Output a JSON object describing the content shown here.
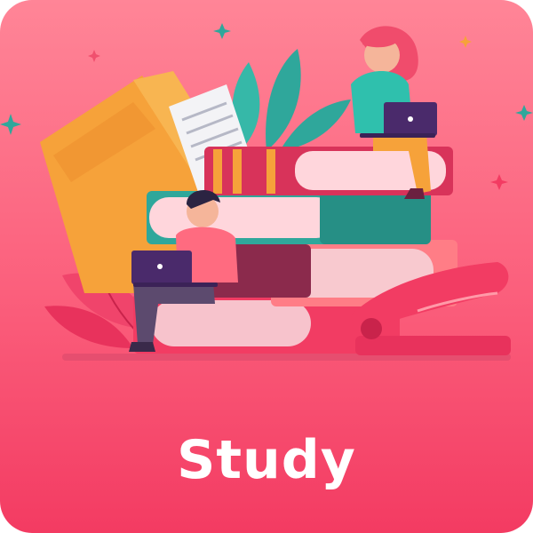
{
  "card": {
    "title": "Study",
    "illustration": "students-studying-on-stack-of-books",
    "colors": {
      "background_top": "#ff8597",
      "background_bottom": "#f33b62",
      "title_text": "#ffffff",
      "accent_orange": "#f6a23a",
      "accent_teal": "#2fa79b",
      "accent_maroon": "#8b2a4c"
    }
  }
}
